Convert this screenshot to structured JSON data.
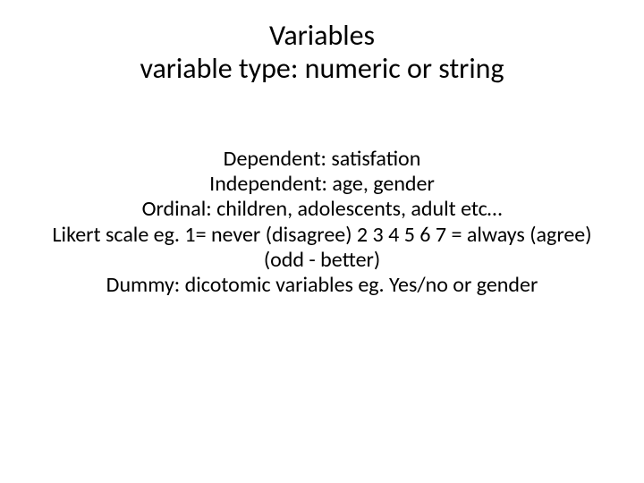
{
  "title": {
    "line1": "Variables",
    "line2": "variable type: numeric or string"
  },
  "body": {
    "line1": "Dependent: satisfation",
    "line2": "Independent: age, gender",
    "line3": "Ordinal: children, adolescents, adult etc…",
    "line4": "Likert scale eg. 1= never (disagree) 2 3 4 5 6 7 = always (agree) (odd - better)",
    "line5": "Dummy: dicotomic variables eg. Yes/no or gender"
  }
}
